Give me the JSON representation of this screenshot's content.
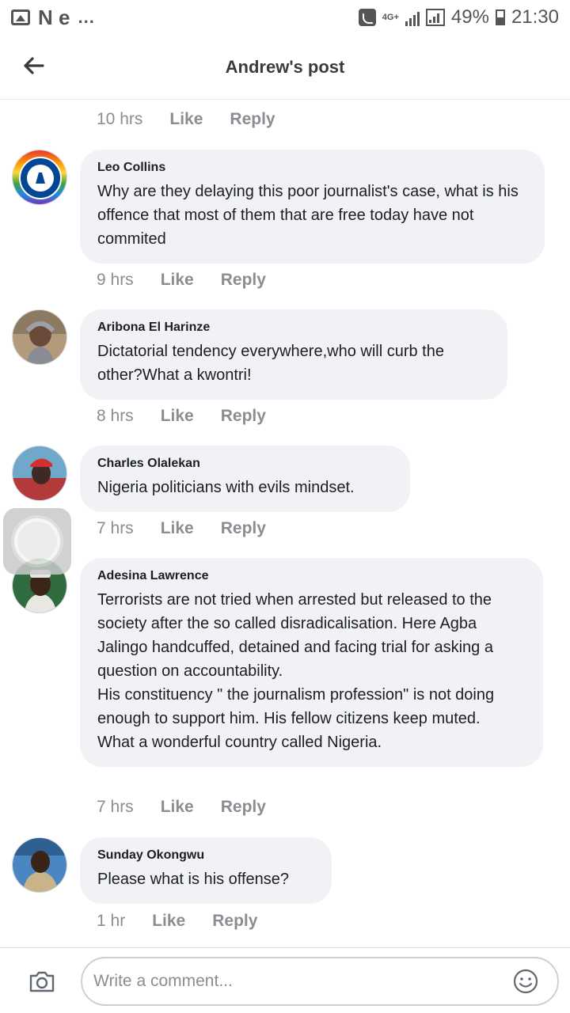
{
  "status_bar": {
    "time": "21:30",
    "battery": "49%",
    "network": "4G+",
    "left_text": "N e",
    "dots": "...",
    "battery_level": 0.49
  },
  "header": {
    "title": "Andrew's post",
    "back_icon": "arrow-left-icon"
  },
  "comments": [
    {
      "author": "",
      "text": "",
      "time": "10 hrs",
      "like": "Like",
      "reply": "Reply"
    },
    {
      "author": "Leo Collins",
      "text": "Why are they delaying this poor journalist's case, what is his offence that most of them that are free today have not commited",
      "time": "9 hrs",
      "like": "Like",
      "reply": "Reply",
      "avatar": "chelsea-badge-avatar"
    },
    {
      "author": "Aribona El Harinze",
      "text": "Dictatorial tendency everywhere,who will curb the other?What a kwontri!",
      "time": "8 hrs",
      "like": "Like",
      "reply": "Reply",
      "avatar": "user-avatar"
    },
    {
      "author": "Charles Olalekan",
      "text": "Nigeria politicians with evils mindset.",
      "time": "7 hrs",
      "like": "Like",
      "reply": "Reply",
      "avatar": "user-avatar"
    },
    {
      "author": "Adesina Lawrence",
      "text": "Terrorists are not tried when arrested but released to the society after the so called disradicalisation. Here Agba Jalingo handcuffed, detained and facing trial for asking a question on accountability.\nHis constituency \" the journalism profession\" is not doing enough to support him. His fellow citizens keep muted.\nWhat a wonderful country called Nigeria.",
      "time": "7 hrs",
      "like": "Like",
      "reply": "Reply",
      "avatar": "user-avatar"
    },
    {
      "author": "Sunday Okongwu",
      "text": "Please what is his offense?",
      "time": "1 hr",
      "like": "Like",
      "reply": "Reply",
      "avatar": "user-avatar"
    }
  ],
  "composer": {
    "placeholder": "Write a comment...",
    "camera_icon": "camera-icon",
    "emoji_icon": "smiley-icon"
  },
  "colors": {
    "bubble_bg": "#f0f2f5",
    "meta_text": "#8a8d91",
    "divider": "#e4e6eb"
  }
}
